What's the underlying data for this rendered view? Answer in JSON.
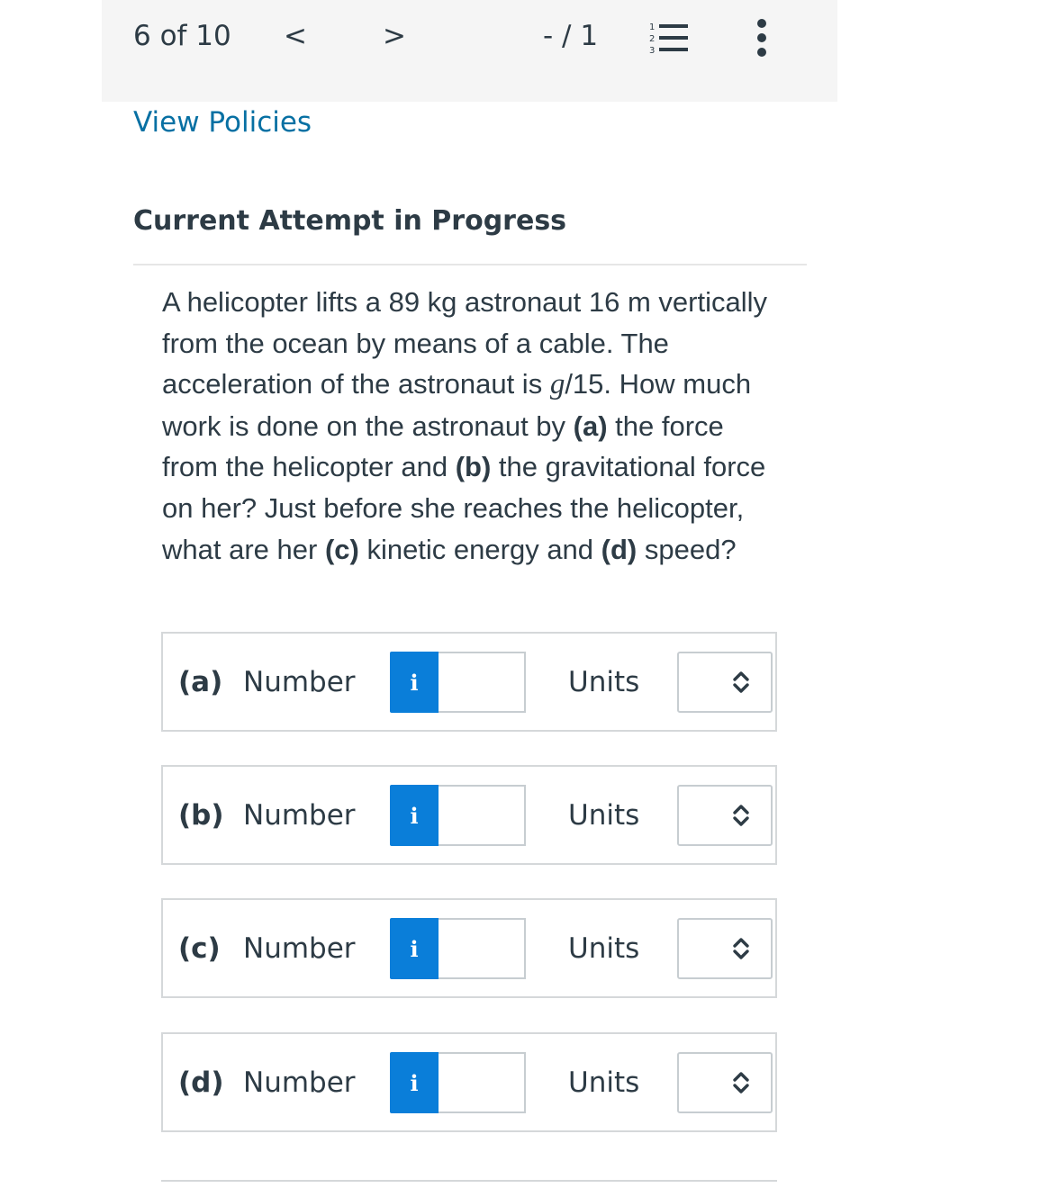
{
  "toolbar": {
    "question_counter": "6 of 10",
    "prev_label": "<",
    "next_label": ">",
    "score": "- / 1",
    "list_icon": "numbered-list-icon",
    "more_icon": "vertical-ellipsis-icon"
  },
  "links": {
    "view_policies": "View Policies"
  },
  "status": {
    "attempt": "Current Attempt in Progress"
  },
  "question": {
    "s1": "A helicopter lifts a 89 kg astronaut 16 m vertically from the ocean by means of a cable. The acceleration of the astronaut is ",
    "g": "g",
    "s2": "/15. How much work is done on the astronaut by ",
    "a": "(a)",
    "s3": " the force from the helicopter and ",
    "b": "(b)",
    "s4": " the gravitational force on her? Just before she reaches the helicopter, what are her ",
    "c": "(c)",
    "s5": " kinetic energy and ",
    "d": "(d)",
    "s6": " speed?"
  },
  "answers": [
    {
      "part": "(a)",
      "number_label": "Number",
      "info": "i",
      "value": "",
      "units_label": "Units",
      "unit_selected": ""
    },
    {
      "part": "(b)",
      "number_label": "Number",
      "info": "i",
      "value": "",
      "units_label": "Units",
      "unit_selected": ""
    },
    {
      "part": "(c)",
      "number_label": "Number",
      "info": "i",
      "value": "",
      "units_label": "Units",
      "unit_selected": ""
    },
    {
      "part": "(d)",
      "number_label": "Number",
      "info": "i",
      "value": "",
      "units_label": "Units",
      "unit_selected": ""
    }
  ],
  "colors": {
    "link": "#0770a3",
    "info_button": "#0a7ed9",
    "text": "#2d3b45",
    "topbar_bg": "#f5f5f5"
  }
}
